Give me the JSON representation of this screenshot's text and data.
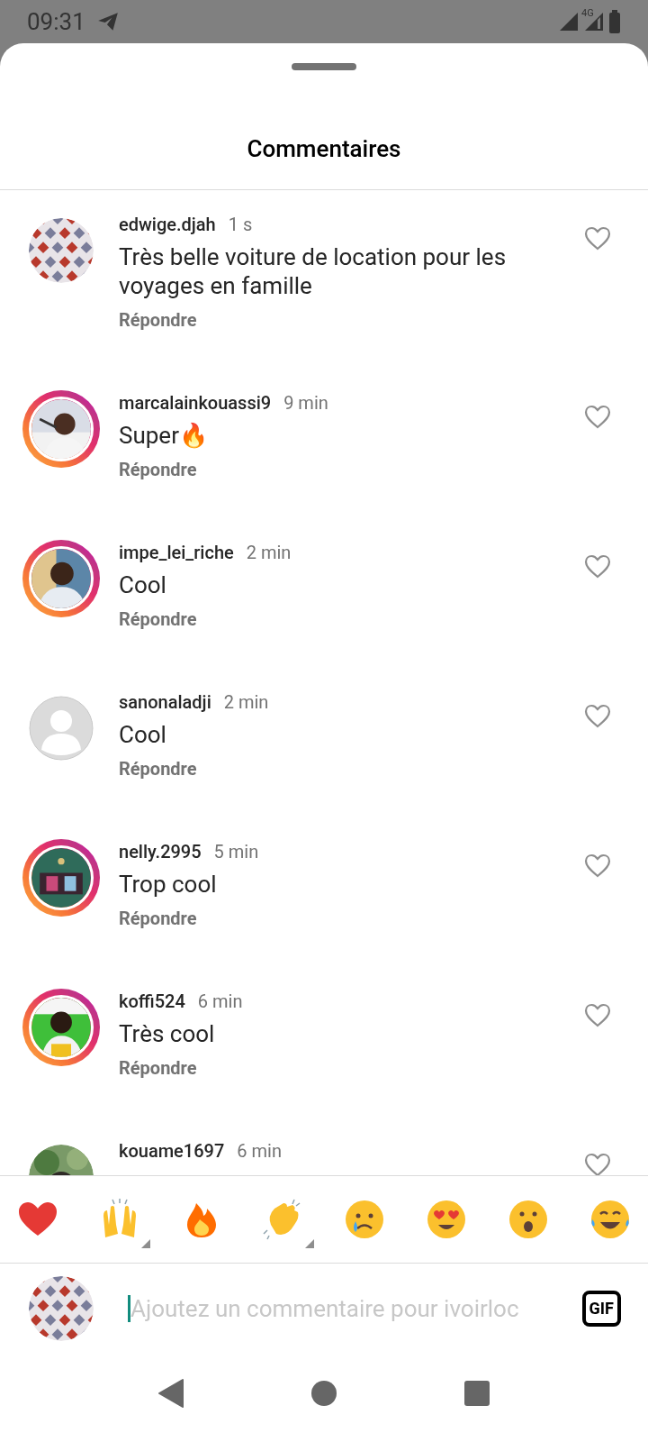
{
  "status_bar": {
    "time": "09:31",
    "network": "4G"
  },
  "sheet": {
    "title": "Commentaires"
  },
  "comments": [
    {
      "username": "edwige.djah",
      "time": "1 s",
      "text": "Très belle voiture de location pour les voyages en famille",
      "reply": "Répondre",
      "avatar": {
        "kind": "picture",
        "story": false
      },
      "liked": false
    },
    {
      "username": "marcalainkouassi9",
      "time": "9 min",
      "text": "Super🔥",
      "reply": "Répondre",
      "avatar": {
        "kind": "picture",
        "story": true
      },
      "liked": false
    },
    {
      "username": "impe_lei_riche",
      "time": "2 min",
      "text": "Cool",
      "reply": "Répondre",
      "avatar": {
        "kind": "picture",
        "story": true
      },
      "liked": false
    },
    {
      "username": "sanonaladji",
      "time": "2 min",
      "text": "Cool",
      "reply": "Répondre",
      "avatar": {
        "kind": "default",
        "story": false
      },
      "liked": false
    },
    {
      "username": "nelly.2995",
      "time": "5 min",
      "text": "Trop cool",
      "reply": "Répondre",
      "avatar": {
        "kind": "picture",
        "story": true
      },
      "liked": false
    },
    {
      "username": "koffi524",
      "time": "6 min",
      "text": "Très cool",
      "reply": "Répondre",
      "avatar": {
        "kind": "picture",
        "story": true
      },
      "liked": false
    },
    {
      "username": "kouame1697",
      "time": "6 min",
      "avatar": {
        "kind": "picture",
        "story": false
      }
    }
  ],
  "reactions": [
    {
      "kind": "heart",
      "variants": false
    },
    {
      "kind": "raised-hands",
      "variants": true
    },
    {
      "kind": "fire",
      "variants": false
    },
    {
      "kind": "clapping-hands",
      "variants": true
    },
    {
      "kind": "crying-face",
      "variants": false
    },
    {
      "kind": "heart-eyes-face",
      "variants": false
    },
    {
      "kind": "surprised-face",
      "variants": false
    },
    {
      "kind": "laughing-face",
      "variants": false
    }
  ],
  "composer": {
    "placeholder": "Ajoutez un commentaire pour ivoirloc",
    "avatar": {
      "kind": "picture"
    },
    "gif_button": "GIF"
  }
}
